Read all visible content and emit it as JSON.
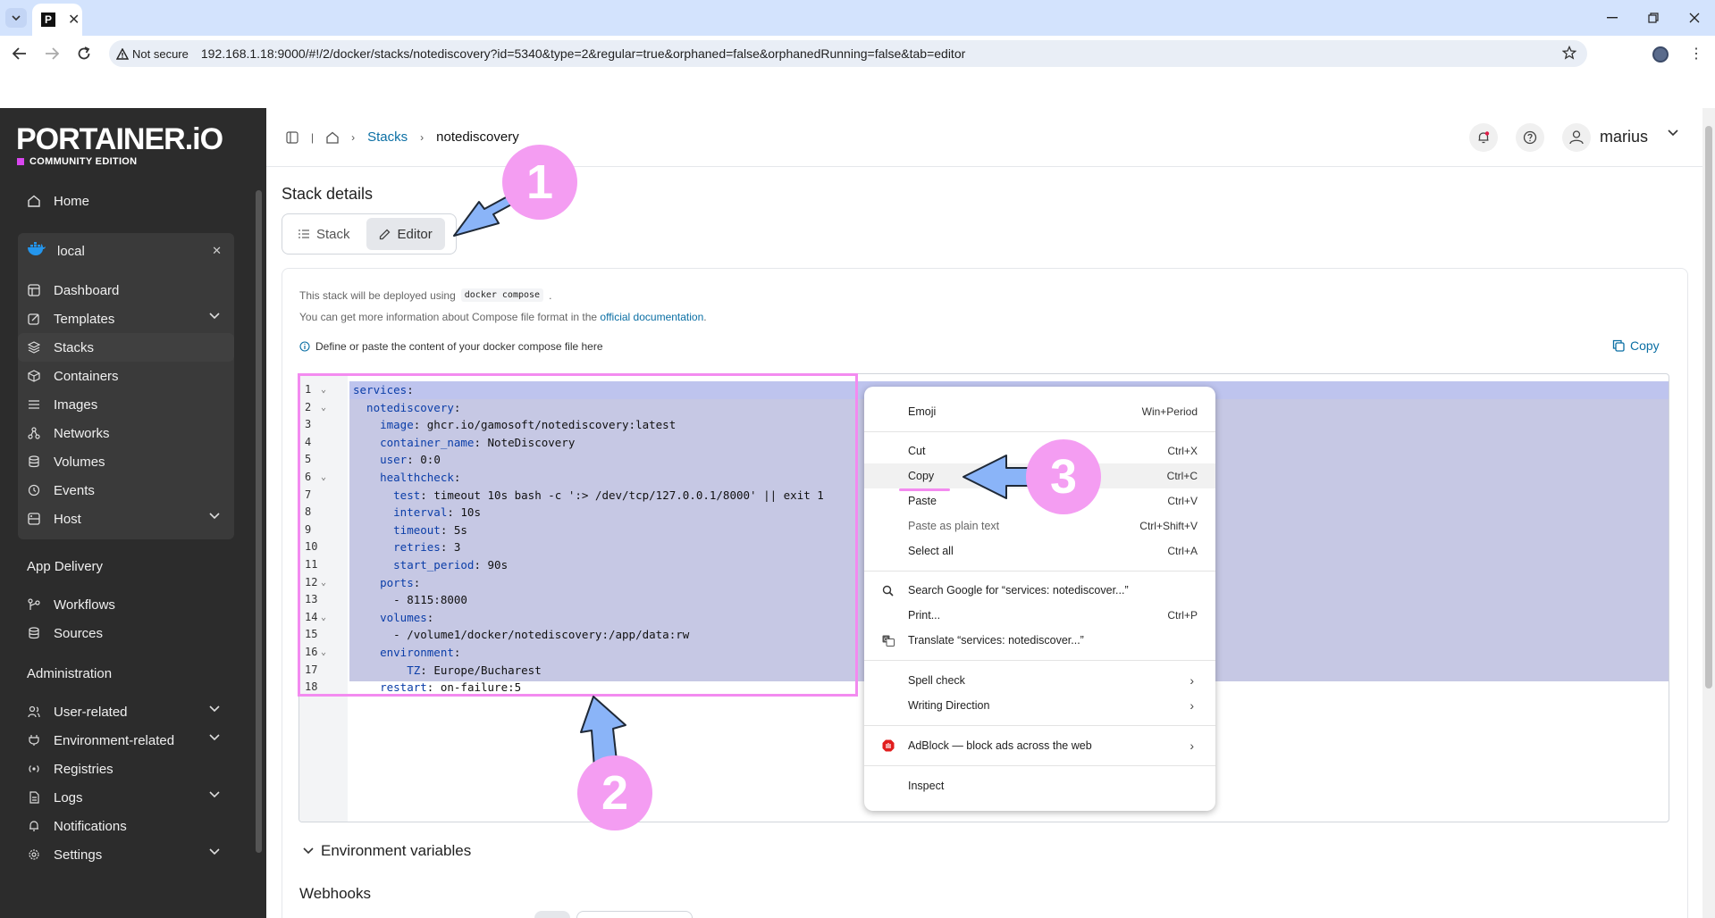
{
  "browser": {
    "tab_favicon": "P",
    "not_secure_label": "Not secure",
    "url": "192.168.1.18:9000/#!/2/docker/stacks/notediscovery?id=5340&type=2&regular=true&orphaned=false&orphanedRunning=false&tab=editor"
  },
  "sidebar": {
    "logo": "PORTAINER.iO",
    "edition": "COMMUNITY EDITION",
    "home": "Home",
    "environment": "local",
    "env_items": [
      {
        "label": "Dashboard",
        "icon": "dashboard-icon"
      },
      {
        "label": "Templates",
        "icon": "template-icon"
      },
      {
        "label": "Stacks",
        "icon": "layers-icon"
      },
      {
        "label": "Containers",
        "icon": "box-icon"
      },
      {
        "label": "Images",
        "icon": "list-icon"
      },
      {
        "label": "Networks",
        "icon": "network-icon"
      },
      {
        "label": "Volumes",
        "icon": "database-icon"
      },
      {
        "label": "Events",
        "icon": "history-icon"
      },
      {
        "label": "Host",
        "icon": "server-icon"
      }
    ],
    "app_delivery": "App Delivery",
    "workflows": "Workflows",
    "sources": "Sources",
    "administration": "Administration",
    "admin_items": [
      {
        "label": "User-related"
      },
      {
        "label": "Environment-related"
      },
      {
        "label": "Registries"
      },
      {
        "label": "Logs"
      },
      {
        "label": "Notifications"
      },
      {
        "label": "Settings"
      }
    ]
  },
  "header": {
    "breadcrumb_stacks": "Stacks",
    "breadcrumb_current": "notediscovery",
    "username": "marius"
  },
  "page": {
    "title": "Stack details",
    "tab_stack": "Stack",
    "tab_editor": "Editor",
    "info_deploy_prefix": "This stack will be deployed using",
    "info_deploy_code": "docker compose",
    "info_deploy_suffix": ".",
    "info_more_prefix": "You can get more information about Compose file format in the",
    "info_more_link": "official documentation",
    "info_more_suffix": ".",
    "define_hint": "Define or paste the content of your docker compose file here",
    "copy_label": "Copy",
    "env_vars_label": "Environment variables",
    "webhooks_label": "Webhooks"
  },
  "editor": {
    "lines": [
      {
        "n": "1",
        "fold": true,
        "key": "services",
        "rest": ":"
      },
      {
        "n": "2",
        "fold": true,
        "key": "  notediscovery",
        "rest": ":"
      },
      {
        "n": "3",
        "fold": false,
        "key": "    image",
        "rest": ": ghcr.io/gamosoft/notediscovery:latest"
      },
      {
        "n": "4",
        "fold": false,
        "key": "    container_name",
        "rest": ": NoteDiscovery"
      },
      {
        "n": "5",
        "fold": false,
        "key": "    user",
        "rest": ": 0:0"
      },
      {
        "n": "6",
        "fold": true,
        "key": "    healthcheck",
        "rest": ":"
      },
      {
        "n": "7",
        "fold": false,
        "key": "      test",
        "rest": ": timeout 10s bash -c ':> /dev/tcp/127.0.0.1/8000' || exit 1"
      },
      {
        "n": "8",
        "fold": false,
        "key": "      interval",
        "rest": ": 10s"
      },
      {
        "n": "9",
        "fold": false,
        "key": "      timeout",
        "rest": ": 5s"
      },
      {
        "n": "10",
        "fold": false,
        "key": "      retries",
        "rest": ": 3"
      },
      {
        "n": "11",
        "fold": false,
        "key": "      start_period",
        "rest": ": 90s"
      },
      {
        "n": "12",
        "fold": true,
        "key": "    ports",
        "rest": ":"
      },
      {
        "n": "13",
        "fold": false,
        "key": "",
        "rest": "      - 8115:8000"
      },
      {
        "n": "14",
        "fold": true,
        "key": "    volumes",
        "rest": ":"
      },
      {
        "n": "15",
        "fold": false,
        "key": "",
        "rest": "      - /volume1/docker/notediscovery:/app/data:rw"
      },
      {
        "n": "16",
        "fold": true,
        "key": "    environment",
        "rest": ":"
      },
      {
        "n": "17",
        "fold": false,
        "key": "        TZ",
        "rest": ": Europe/Bucharest"
      },
      {
        "n": "18",
        "fold": false,
        "key": "    restart",
        "rest": ": on-failure:5"
      }
    ]
  },
  "context_menu": {
    "emoji": "Emoji",
    "emoji_sc": "Win+Period",
    "cut": "Cut",
    "cut_sc": "Ctrl+X",
    "copy": "Copy",
    "copy_sc": "Ctrl+C",
    "paste": "Paste",
    "paste_sc": "Ctrl+V",
    "paste_plain": "Paste as plain text",
    "paste_plain_sc": "Ctrl+Shift+V",
    "select_all": "Select all",
    "select_all_sc": "Ctrl+A",
    "search_google": "Search Google for “services:   notediscover...”",
    "print": "Print...",
    "print_sc": "Ctrl+P",
    "translate": "Translate “services:   notediscover...”",
    "spell_check": "Spell check",
    "writing_direction": "Writing Direction",
    "adblock": "AdBlock — block ads across the web",
    "inspect": "Inspect"
  },
  "annotations": {
    "step1": "1",
    "step2": "2",
    "step3": "3",
    "highlight_color": "#f38bf0",
    "arrow_color": "#8ab4f8"
  }
}
